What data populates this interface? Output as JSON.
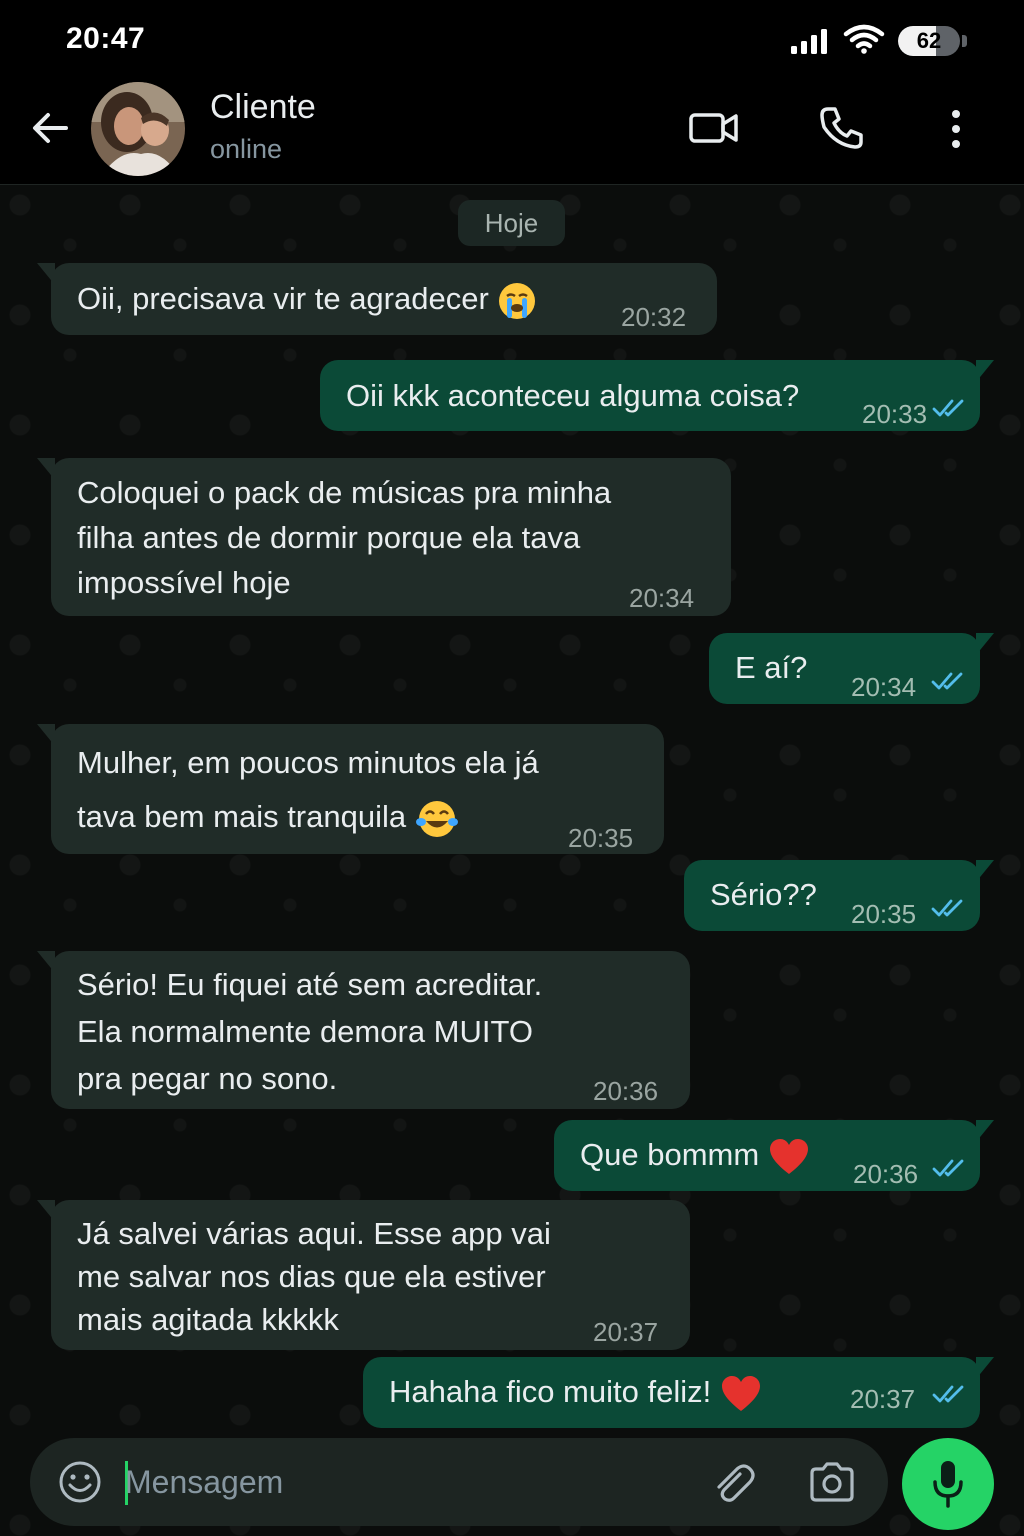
{
  "status_bar": {
    "time": "20:47",
    "battery": "62",
    "battery_level_percent": 62
  },
  "header": {
    "contact_name": "Cliente",
    "contact_status": "online"
  },
  "date_chip": "Hoje",
  "messages": [
    {
      "direction": "in",
      "text": "Oii, precisava vir te agradecer",
      "emoji": "loudly-crying-face",
      "time": "20:32"
    },
    {
      "direction": "out",
      "text": "Oii kkk aconteceu alguma coisa?",
      "time": "20:33",
      "read": true
    },
    {
      "direction": "in",
      "text": "Coloquei o pack de músicas pra minha\nfilha antes de dormir porque ela tava\nimpossível hoje",
      "time": "20:34"
    },
    {
      "direction": "out",
      "text": "E aí?",
      "time": "20:34",
      "read": true
    },
    {
      "direction": "in",
      "text": "Mulher, em poucos minutos ela já\ntava bem mais tranquila",
      "emoji": "face-with-tears-of-joy",
      "time": "20:35"
    },
    {
      "direction": "out",
      "text": "Sério??",
      "time": "20:35",
      "read": true
    },
    {
      "direction": "in",
      "text": "Sério! Eu fiquei até sem acreditar.\nEla normalmente demora MUITO\npra pegar no sono.",
      "time": "20:36"
    },
    {
      "direction": "out",
      "text": "Que bommm",
      "emoji": "red-heart",
      "time": "20:36",
      "read": true
    },
    {
      "direction": "in",
      "text": "Já salvei várias aqui. Esse app vai\nme salvar nos dias que ela estiver\nmais agitada kkkkk",
      "time": "20:37"
    },
    {
      "direction": "out",
      "text": "Hahaha fico muito feliz!",
      "emoji": "red-heart",
      "time": "20:37",
      "read": true
    }
  ],
  "composer": {
    "placeholder": "Mensagem"
  },
  "colors": {
    "incoming_bubble": "#202c28",
    "outgoing_bubble": "#0b4a37",
    "read_ticks": "#53bdeb",
    "accent": "#25d366"
  }
}
